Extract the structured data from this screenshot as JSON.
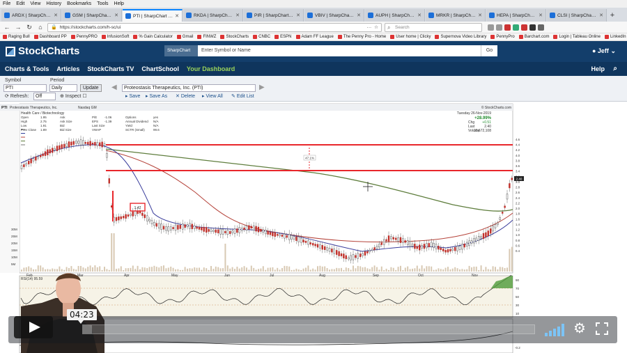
{
  "browser": {
    "menu": [
      "File",
      "Edit",
      "View",
      "History",
      "Bookmarks",
      "Tools",
      "Help"
    ],
    "tabs": [
      {
        "label": "ARDX | SharpChart | Stoc",
        "active": false
      },
      {
        "label": "GSM | SharpChart | Stoc",
        "active": false
      },
      {
        "label": "PTI | SharpChart | Stoc",
        "active": true
      },
      {
        "label": "RKDA | SharpChart | Stoc",
        "active": false
      },
      {
        "label": "PIR | SharpChart | Stock",
        "active": false
      },
      {
        "label": "VBIV | SharpChart | Stoc",
        "active": false
      },
      {
        "label": "AUPH | SharpChart | Stoc",
        "active": false
      },
      {
        "label": "MRKR | SharpChart | Stoc",
        "active": false
      },
      {
        "label": "HEPA | SharpChart | Stoc",
        "active": false
      },
      {
        "label": "CLSI | SharpChart | Stoc",
        "active": false
      }
    ],
    "url": "https://stockcharts.com/h-sc/ui",
    "search_placeholder": "Search",
    "bookmarks": [
      "Raging Bull",
      "Dashboard PP",
      "PennyPRO",
      "InfusionSoft",
      "% Gain Calculator",
      "Gmail",
      "FINWZ",
      "StockCharts",
      "CNBC",
      "ESPN",
      "Adam FF League",
      "The Penny Pro - Home",
      "User home | Clicky",
      "Supernova Video Library",
      "PennyPro",
      "Barchart.com",
      "Login | Tableau Online",
      "LinkedIn"
    ]
  },
  "site": {
    "logo": "StockCharts",
    "search_type": "SharpChart",
    "search_placeholder": "Enter Symbol or Name",
    "go_label": "Go",
    "user": "Jeff",
    "nav": [
      "Charts & Tools",
      "Articles",
      "StockCharts TV",
      "ChartSchool",
      "Your Dashboard"
    ],
    "help": "Help"
  },
  "controls": {
    "symbol_label": "Symbol",
    "symbol_value": "PTI",
    "period_label": "Period",
    "period_value": "Daily",
    "update_label": "Update",
    "security_name": "Proteostasis Therapeutics, Inc. (PTI)",
    "refresh_label": "Refresh:",
    "refresh_value": "Off",
    "inspect_label": "Inspect",
    "save": "Save",
    "save_as": "Save As",
    "delete": "Delete",
    "view_all": "View All",
    "edit_list": "Edit List"
  },
  "chart": {
    "symbol": "PTI",
    "company": "Proteostasis Therapeutics, Inc.",
    "exchange": "Nasdaq GM",
    "sector": "Health Care / Biotechnology",
    "date": "Tuesday 26-Nov-2019",
    "change_pct": "+28.99%",
    "change_label": "Chg",
    "change": "+0.51",
    "last_label": "Last",
    "last": "2.40",
    "volume_label": "Volume",
    "volume": "13,672,108",
    "watermark": "© StockCharts.com",
    "rsi_label": "RSI(14) 95.59",
    "gap_label": "47.1%",
    "callout": "1.42",
    "stats": [
      [
        "Open",
        "1.95",
        "Ask",
        "",
        "P/E",
        "-1.06",
        "Options",
        "yes"
      ],
      [
        "High",
        "2.75",
        "Ask Size",
        "",
        "EPS",
        "-1.39",
        "Annual Dividend",
        "N/A"
      ],
      [
        "Low",
        "1.91",
        "Bid",
        "",
        "Last Size",
        "",
        "Yield",
        "N/A"
      ],
      [
        "Prev Close",
        "1.89",
        "Bid Size",
        "",
        "VWAP",
        "",
        "SCTR (Small)",
        "99.6"
      ]
    ],
    "volume_ticks": [
      "30M",
      "25M",
      "20M",
      "15M",
      "10M",
      "5M"
    ],
    "right_ticks": [
      "4.6",
      "4.4",
      "4.2",
      "4.0",
      "3.8",
      "3.6",
      "3.4",
      "3.2",
      "3.0",
      "2.8",
      "2.6",
      "2.4",
      "2.2",
      "2.0",
      "1.8",
      "1.6",
      "1.4",
      "1.2",
      "1.0",
      "0.8",
      "0.6",
      "0.4"
    ],
    "rsi_ticks": [
      "90",
      "70",
      "50",
      "30",
      "10"
    ],
    "bottom_tick": "-0.2",
    "month_labels": [
      "Feb",
      "Mar",
      "Apr",
      "May",
      "Jun",
      "Jul",
      "Aug",
      "Sep",
      "Oct",
      "Nov"
    ]
  },
  "video": {
    "time": "04:23",
    "progress": 0.02
  },
  "colors": {
    "accent_red": "#e8262b",
    "ma_green": "#5e7d3c",
    "ma_red": "#b5433a",
    "ma_blue": "#3a3d9c",
    "nav_bg": "#133e6b",
    "dashboard_green": "#9bd35a"
  }
}
